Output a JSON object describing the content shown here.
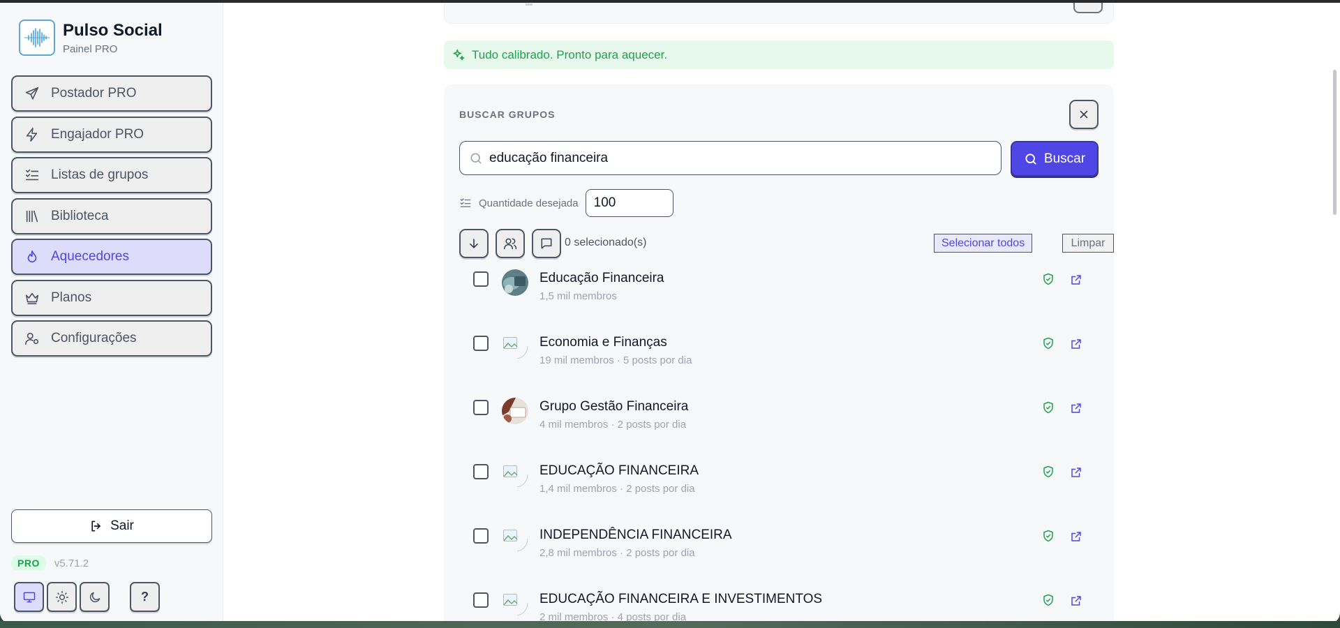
{
  "brand": {
    "title": "Pulso Social",
    "subtitle": "Painel PRO"
  },
  "nav": [
    {
      "label": "Postador PRO",
      "icon": "send-icon"
    },
    {
      "label": "Engajador PRO",
      "icon": "lightning-icon"
    },
    {
      "label": "Listas de grupos",
      "icon": "checklist-icon"
    },
    {
      "label": "Biblioteca",
      "icon": "library-icon"
    },
    {
      "label": "Aquecedores",
      "icon": "flame-icon",
      "active": true
    },
    {
      "label": "Planos",
      "icon": "crown-icon"
    },
    {
      "label": "Configurações",
      "icon": "user-settings-icon"
    }
  ],
  "logout": {
    "label": "Sair"
  },
  "footer": {
    "badge": "PRO",
    "version": "v5.71.2",
    "help": "?"
  },
  "alert": {
    "text": "Tudo calibrado. Pronto para aquecer."
  },
  "search_panel": {
    "title": "BUSCAR GRUPOS",
    "query": "educação financeira",
    "search_button": "Buscar",
    "quantity_label": "Quantidade desejada",
    "quantity_value": "100",
    "selected_count": "0 selecionado(s)",
    "select_all": "Selecionar todos",
    "clear": "Limpar"
  },
  "groups": [
    {
      "name": "Educação Financeira",
      "meta": "1,5 mil membros",
      "avatar": "photo"
    },
    {
      "name": "Economia e Finanças",
      "meta": "19 mil membros · 5 posts por dia",
      "avatar": "broken"
    },
    {
      "name": "Grupo Gestão Financeira",
      "meta": "4 mil membros · 2 posts por dia",
      "avatar": "photo"
    },
    {
      "name": "EDUCAÇÃO FINANCEIRA",
      "meta": "1,4 mil membros · 2 posts por dia",
      "avatar": "broken"
    },
    {
      "name": "INDEPENDÊNCIA FINANCEIRA",
      "meta": "2,8 mil membros · 2 posts por dia",
      "avatar": "broken"
    },
    {
      "name": "EDUCAÇÃO FINANCEIRA E INVESTIMENTOS",
      "meta": "2 mil membros · 4 posts por dia",
      "avatar": "broken"
    }
  ],
  "colors": {
    "accent": "#4f46e5",
    "success": "#22a04b",
    "active_nav_bg": "#dedcfb"
  }
}
